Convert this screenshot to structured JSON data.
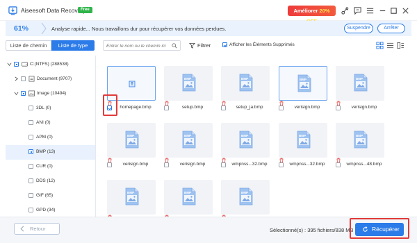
{
  "app": {
    "title": "Aiseesoft Data Recovery",
    "badge": "Free"
  },
  "upgrade": {
    "label": "Améliorer",
    "discount": "20% OFF"
  },
  "progress": {
    "percent_text": "61%",
    "value": 0.61,
    "message": "Analyse rapide... Nous travaillons dur pour récupérer vos données perdues.",
    "pause_label": "Suspendre",
    "stop_label": "Arrêter"
  },
  "toolbar": {
    "tabs": [
      {
        "label": "Liste de chemin"
      },
      {
        "label": "Liste de type",
        "active": true
      }
    ],
    "search_placeholder": "Entrer le nom ou le chemin ici",
    "filter_label": "Filtrer",
    "show_deleted_label": "Afficher les Éléments Supprimés"
  },
  "tree": [
    {
      "label": "C:(NTFS) (288538)"
    },
    {
      "label": "Document (9707)"
    },
    {
      "label": "Image (10494)"
    },
    {
      "label": "3DL (0)"
    },
    {
      "label": "ANI (0)"
    },
    {
      "label": "APM (0)"
    },
    {
      "label": "BMP (13)",
      "selected": true
    },
    {
      "label": "CUR (0)"
    },
    {
      "label": "DDS (12)"
    },
    {
      "label": "GIF (65)"
    },
    {
      "label": "GPD (34)"
    }
  ],
  "files": [
    {
      "name": "homepage.bmp",
      "checked": true
    },
    {
      "name": "setup.bmp"
    },
    {
      "name": "setup_ja.bmp"
    },
    {
      "name": "verisign.bmp"
    },
    {
      "name": "verisign.bmp"
    },
    {
      "name": "verisign.bmp"
    },
    {
      "name": "verisign.bmp"
    },
    {
      "name": "wmpnss...32.bmp"
    },
    {
      "name": "wmpnss...32.bmp"
    },
    {
      "name": "wmpnss...48.bmp"
    },
    {
      "name": ""
    },
    {
      "name": ""
    },
    {
      "name": ""
    }
  ],
  "file_type_label": "BMP",
  "footer": {
    "back_label": "Retour",
    "selected_text": "Sélectionné(s) : 395 fichiers/838 MB",
    "recover_label": "Récupérer"
  },
  "colors": {
    "accent": "#2b7be8",
    "upgrade": "#ee3b3b",
    "highlight": "#e23a3a"
  }
}
